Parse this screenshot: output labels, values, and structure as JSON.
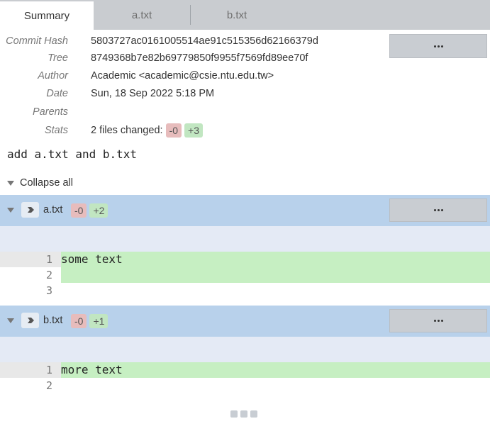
{
  "tabs": [
    {
      "label": "Summary"
    },
    {
      "label": "a.txt"
    },
    {
      "label": "b.txt"
    }
  ],
  "info": {
    "commit_hash_label": "Commit Hash",
    "commit_hash": "5803727ac0161005514ae91c515356d62166379d",
    "tree_label": "Tree",
    "tree": "8749368b7e82b69779850f9955f7569fd89ee70f",
    "author_label": "Author",
    "author": "Academic <academic@csie.ntu.edu.tw>",
    "date_label": "Date",
    "date": "Sun, 18 Sep 2022 5:18 PM",
    "parents_label": "Parents",
    "parents": "",
    "stats_label": "Stats",
    "stats_text": "2 files changed:",
    "stats_del": "-0",
    "stats_add": "+3"
  },
  "commit_message": "add a.txt and b.txt",
  "collapse_all_label": "Collapse all",
  "files": [
    {
      "name": "a.txt",
      "del": "-0",
      "add": "+2",
      "lines": [
        {
          "no": "1",
          "text": "some text",
          "added": true
        },
        {
          "no": "2",
          "text": "",
          "added": true
        },
        {
          "no": "3",
          "text": "",
          "added": false
        }
      ]
    },
    {
      "name": "b.txt",
      "del": "-0",
      "add": "+1",
      "lines": [
        {
          "no": "1",
          "text": "more text",
          "added": true
        },
        {
          "no": "2",
          "text": "",
          "added": false
        }
      ]
    }
  ],
  "icons": {
    "more": "ellipsis-icon",
    "collapse": "triangle-down-icon",
    "file": "chevron-right-icon"
  },
  "colors": {
    "tab_bar": "#c9ccd0",
    "file_header": "#b8d1eb",
    "hunk_separator": "#e4eaf5",
    "added_line": "#c6efc2",
    "badge_del": "#e7bcbc",
    "badge_add": "#c1e6c1"
  }
}
